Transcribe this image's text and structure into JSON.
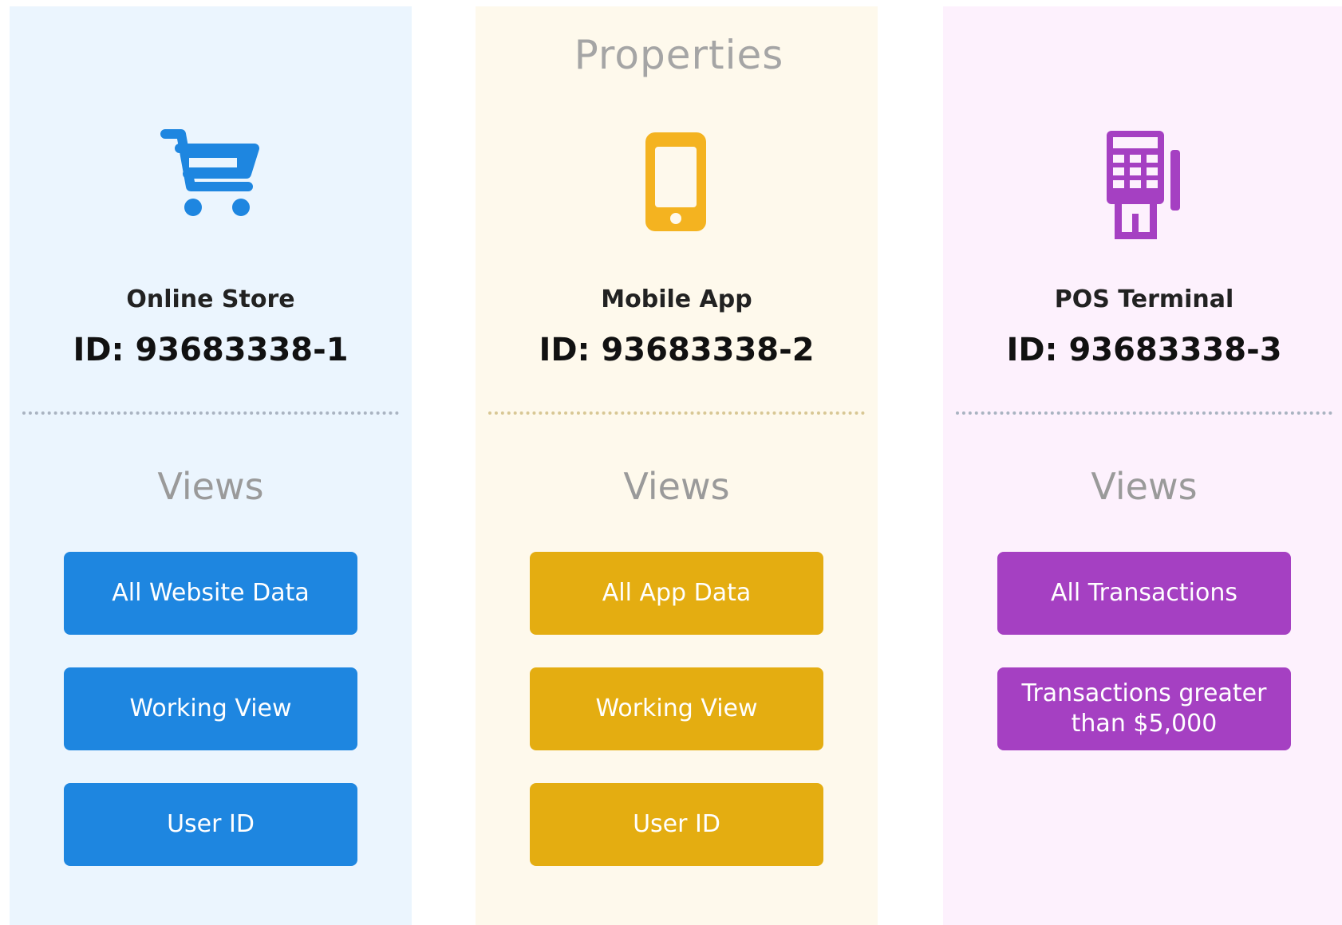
{
  "header": {
    "title": "Properties"
  },
  "colors": {
    "online_store": "#1e86e0",
    "mobile_app": "#e4ad11",
    "pos_terminal": "#a540c2",
    "online_store_bg": "#ebf5fe",
    "mobile_app_bg": "#fef9ec",
    "pos_terminal_bg": "#fdf1fd"
  },
  "properties": [
    {
      "icon": "shopping-cart-icon",
      "name": "Online Store",
      "id_label": "ID: 93683338-1",
      "views_label": "Views",
      "views": [
        "All Website Data",
        "Working View",
        "User ID"
      ]
    },
    {
      "icon": "mobile-phone-icon",
      "name": "Mobile App",
      "id_label": "ID: 93683338-2",
      "views_label": "Views",
      "views": [
        "All App Data",
        "Working View",
        "User ID"
      ]
    },
    {
      "icon": "pos-terminal-icon",
      "name": "POS Terminal",
      "id_label": "ID: 93683338-3",
      "views_label": "Views",
      "views": [
        "All Transactions",
        "Transactions greater than $5,000"
      ]
    }
  ]
}
